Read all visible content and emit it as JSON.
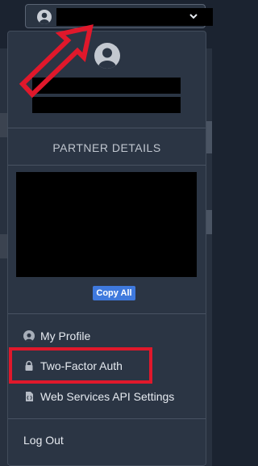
{
  "header": {
    "user_button_icon": "user-avatar-icon",
    "dropdown_icon": "chevron-down-icon"
  },
  "panel": {
    "avatar_icon": "user-avatar-icon",
    "section_title": "PARTNER DETAILS",
    "copy_button_label": "Copy All",
    "menu": [
      {
        "label": "My Profile",
        "icon": "user-icon"
      },
      {
        "label": "Two-Factor Auth",
        "icon": "lock-icon"
      },
      {
        "label": "Web Services API Settings",
        "icon": "file-code-icon"
      }
    ],
    "logout_label": "Log Out"
  },
  "annotations": {
    "color": "#e0182b"
  },
  "colors": {
    "panel_bg": "#2b3544",
    "accent": "#3f79dd"
  }
}
